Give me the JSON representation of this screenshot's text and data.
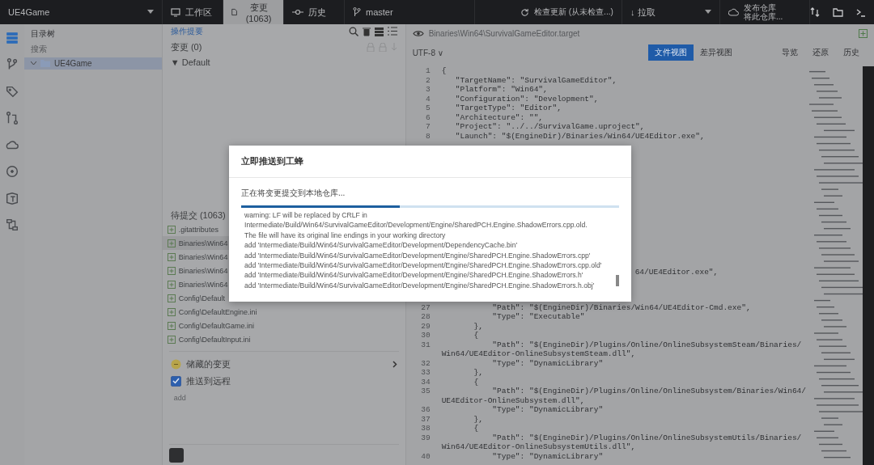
{
  "topbar": {
    "repo": "UE4Game",
    "tabs": [
      {
        "label": "工作区",
        "kind": "workspace",
        "selected": false
      },
      {
        "label": "变更 (1063)",
        "kind": "changes",
        "selected": true
      },
      {
        "label": "历史",
        "kind": "history",
        "selected": false
      }
    ],
    "branch": "master",
    "check": "检查更新 (从未检查...)",
    "pull": "↓ 拉取",
    "publish": {
      "title": "发布仓库",
      "subtitle": "将此仓库..."
    }
  },
  "rail": [
    {
      "kind": "list",
      "selected": true
    },
    {
      "kind": "branch",
      "selected": false
    },
    {
      "kind": "tag",
      "selected": false
    },
    {
      "kind": "merge",
      "selected": false
    },
    {
      "kind": "cloud",
      "selected": false
    },
    {
      "kind": "circle",
      "selected": false
    },
    {
      "kind": "box",
      "selected": false
    },
    {
      "kind": "flow",
      "selected": false
    }
  ],
  "tree": {
    "title": "目录树",
    "search": {
      "placeholder": "搜索"
    },
    "items": [
      {
        "label": "UE4Game",
        "expanded": true,
        "selected": true
      }
    ]
  },
  "changes": {
    "summary_link": "操作提要",
    "staged": "变更 (0)",
    "group": "▼ Default",
    "pending": "待提交 (1063)",
    "files": [
      {
        "name": ".gitattributes",
        "selected": false
      },
      {
        "name": "Binaries\\Win64",
        "selected": true
      },
      {
        "name": "Binaries\\Win64",
        "selected": false
      },
      {
        "name": "Binaries\\Win64",
        "selected": false
      },
      {
        "name": "Binaries\\Win64",
        "selected": false
      },
      {
        "name": "Config\\Default",
        "selected": false
      },
      {
        "name": "Config\\DefaultEngine.ini",
        "selected": false
      },
      {
        "name": "Config\\DefaultGame.ini",
        "selected": false
      },
      {
        "name": "Config\\DefaultInput.ini",
        "selected": false
      }
    ],
    "stash": "储藏的变更",
    "push": {
      "label": "推送到远程",
      "checked": true
    },
    "message": "add"
  },
  "editor": {
    "path": "Binaries\\Win64\\SurvivalGameEditor.target",
    "encoding": "UTF-8 ∨",
    "views": [
      {
        "label": "文件视图",
        "selected": true
      },
      {
        "label": "差异视图",
        "selected": false
      }
    ],
    "actions": [
      "导览",
      "还原",
      "历史"
    ],
    "top_lines": [
      {
        "num": "1",
        "text": "{"
      },
      {
        "num": "2",
        "text": "   \"TargetName\": \"SurvivalGameEditor\","
      },
      {
        "num": "3",
        "text": "   \"Platform\": \"Win64\","
      },
      {
        "num": "4",
        "text": "   \"Configuration\": \"Development\","
      },
      {
        "num": "5",
        "text": "   \"TargetType\": \"Editor\","
      },
      {
        "num": "6",
        "text": "   \"Architecture\": \"\","
      },
      {
        "num": "7",
        "text": "   \"Project\": \"../../SurvivalGame.uproject\","
      },
      {
        "num": "8",
        "text": "   \"Launch\": \"$(EngineDir)/Binaries/Win64/UE4Editor.exe\","
      }
    ],
    "partial_line": "64/UE4Editor.exe\",",
    "bottom_lines": [
      {
        "num": "27",
        "text": "           \"Path\": \"$(EngineDir)/Binaries/Win64/UE4Editor-Cmd.exe\","
      },
      {
        "num": "28",
        "text": "           \"Type\": \"Executable\""
      },
      {
        "num": "29",
        "text": "       },"
      },
      {
        "num": "30",
        "text": "       {"
      },
      {
        "num": "31",
        "text": "           \"Path\": \"$(EngineDir)/Plugins/Online/OnlineSubsystemSteam/Binaries/"
      },
      {
        "text": "Win64/UE4Editor-OnlineSubsystemSteam.dll\","
      },
      {
        "num": "32",
        "text": "           \"Type\": \"DynamicLibrary\""
      },
      {
        "num": "33",
        "text": "       },"
      },
      {
        "num": "34",
        "text": "       {"
      },
      {
        "num": "35",
        "text": "           \"Path\": \"$(EngineDir)/Plugins/Online/OnlineSubsystem/Binaries/Win64/"
      },
      {
        "text": "UE4Editor-OnlineSubsystem.dll\","
      },
      {
        "num": "36",
        "text": "           \"Type\": \"DynamicLibrary\""
      },
      {
        "num": "37",
        "text": "       },"
      },
      {
        "num": "38",
        "text": "       {"
      },
      {
        "num": "39",
        "text": "           \"Path\": \"$(EngineDir)/Plugins/Online/OnlineSubsystemUtils/Binaries/"
      },
      {
        "text": "Win64/UE4Editor-OnlineSubsystemUtils.dll\","
      },
      {
        "num": "40",
        "text": "           \"Type\": \"DynamicLibrary\""
      }
    ]
  },
  "dialog": {
    "title": "立即推送到工蜂",
    "status": "正在将变更提交到本地仓库...",
    "progress": {
      "level": 0.42
    },
    "log": [
      "warning: LF will be replaced by CRLF in",
      "Intermediate/Build/Win64/SurvivalGameEditor/Development/Engine/SharedPCH.Engine.ShadowErrors.cpp.old.",
      "The file will have its original line endings in your working directory",
      "add 'Intermediate/Build/Win64/SurvivalGameEditor/Development/DependencyCache.bin'",
      "add 'Intermediate/Build/Win64/SurvivalGameEditor/Development/Engine/SharedPCH.Engine.ShadowErrors.cpp'",
      "add 'Intermediate/Build/Win64/SurvivalGameEditor/Development/Engine/SharedPCH.Engine.ShadowErrors.cpp.old'",
      "add 'Intermediate/Build/Win64/SurvivalGameEditor/Development/Engine/SharedPCH.Engine.ShadowErrors.h'",
      "add 'Intermediate/Build/Win64/SurvivalGameEditor/Development/Engine/SharedPCH.Engine.ShadowErrors.h.obj'"
    ]
  }
}
